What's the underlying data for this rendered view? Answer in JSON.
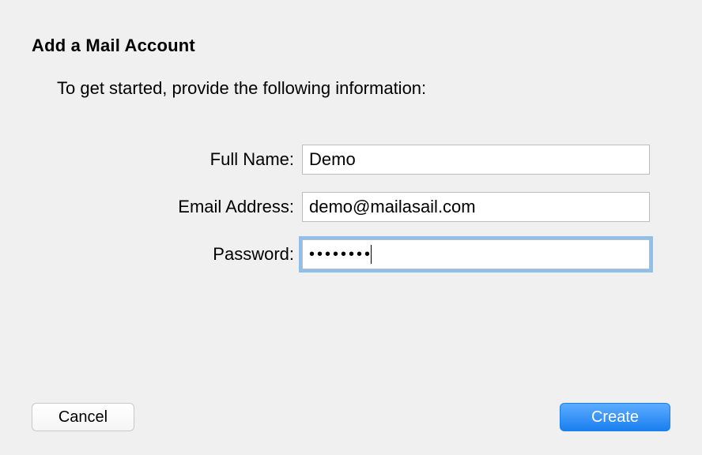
{
  "title": "Add a Mail Account",
  "subtitle": "To get started, provide the following information:",
  "form": {
    "fullName": {
      "label": "Full Name:",
      "value": "Demo"
    },
    "email": {
      "label": "Email Address:",
      "value": "demo@mailasail.com"
    },
    "password": {
      "label": "Password:",
      "masked": "••••••••"
    }
  },
  "buttons": {
    "cancel": "Cancel",
    "create": "Create"
  }
}
